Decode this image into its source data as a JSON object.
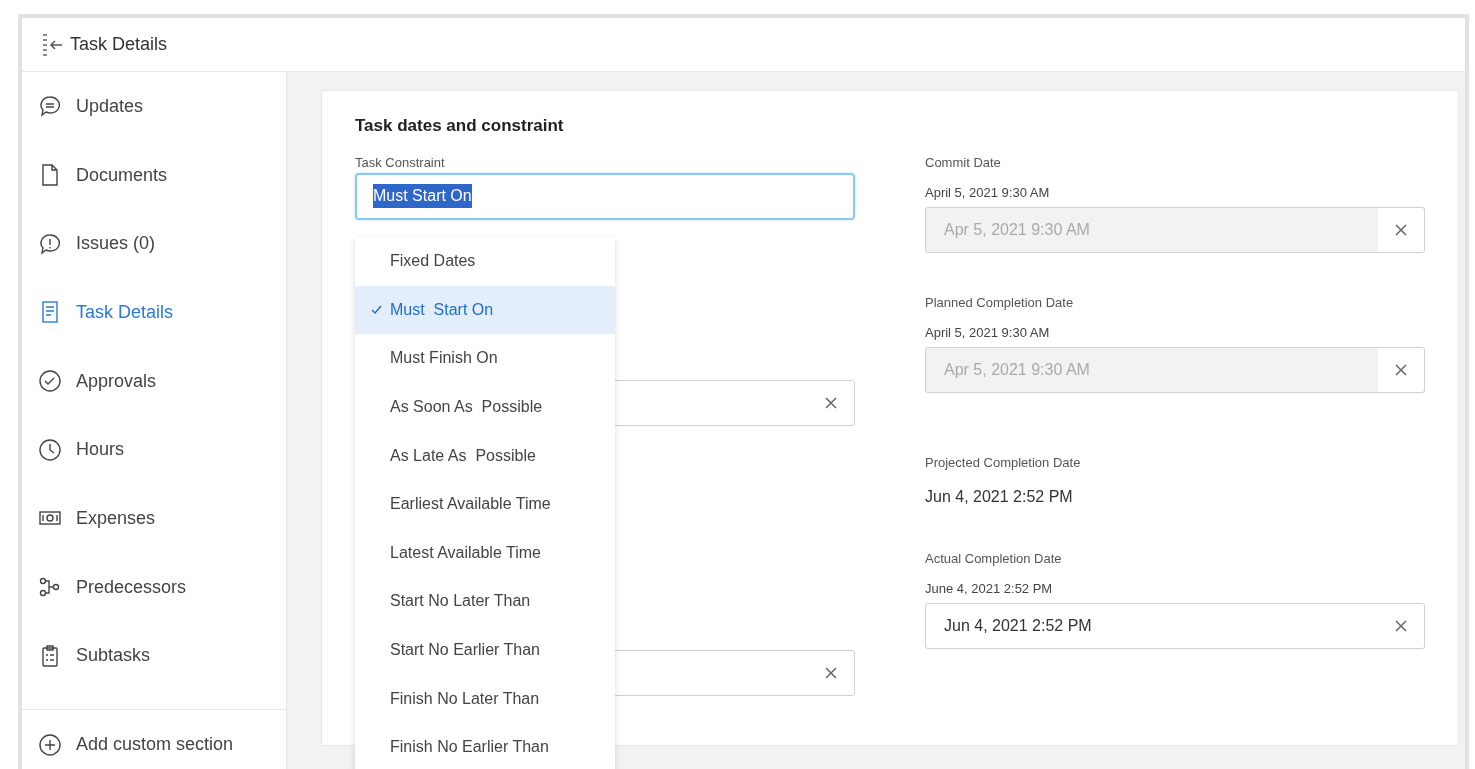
{
  "header": {
    "title": "Task Details"
  },
  "sidebar": {
    "items": [
      {
        "label": "Updates",
        "selected": false
      },
      {
        "label": "Documents",
        "selected": false
      },
      {
        "label": "Issues (0)",
        "selected": false
      },
      {
        "label": "Task Details",
        "selected": true
      },
      {
        "label": "Approvals",
        "selected": false
      },
      {
        "label": "Hours",
        "selected": false
      },
      {
        "label": "Expenses",
        "selected": false
      },
      {
        "label": "Predecessors",
        "selected": false
      },
      {
        "label": "Subtasks",
        "selected": false
      }
    ],
    "add_button": "Add custom section"
  },
  "section": {
    "title": "Task dates and constraint",
    "constraint": {
      "label": "Task Constraint",
      "value": "Must Start On",
      "focused": true
    },
    "hidden_inputs": [
      {
        "kind": "date_input"
      },
      {
        "kind": "date_input"
      }
    ],
    "dropdown": [
      {
        "label": "Fixed Dates",
        "selected": false
      },
      {
        "label": "Must  Start On",
        "selected": true
      },
      {
        "label": "Must Finish On",
        "selected": false
      },
      {
        "label": "As Soon As  Possible",
        "selected": false
      },
      {
        "label": "As Late As  Possible",
        "selected": false
      },
      {
        "label": "Earliest Available Time",
        "selected": false
      },
      {
        "label": "Latest Available Time",
        "selected": false
      },
      {
        "label": "Start No Later Than",
        "selected": false
      },
      {
        "label": "Start No Earlier Than",
        "selected": false
      },
      {
        "label": "Finish No Later Than",
        "selected": false
      },
      {
        "label": "Finish No Earlier Than",
        "selected": false
      }
    ],
    "dates": [
      {
        "kind": "input",
        "label": "Commit Date",
        "text": "April 5, 2021 9:30 AM",
        "value": "Apr 5, 2021 9:30 AM",
        "disabled": true
      },
      {
        "kind": "input",
        "label": "Planned Completion Date",
        "text": "April 5, 2021 9:30 AM",
        "value": "Apr 5, 2021 9:30 AM",
        "disabled": true
      },
      {
        "kind": "readonly",
        "label": "Projected Completion Date",
        "text": "Jun 4, 2021 2:52 PM"
      },
      {
        "kind": "input",
        "label": "Actual Completion Date",
        "text": "June 4, 2021 2:52 PM",
        "value": "Jun 4, 2021 2:52 PM",
        "disabled": false
      }
    ]
  }
}
